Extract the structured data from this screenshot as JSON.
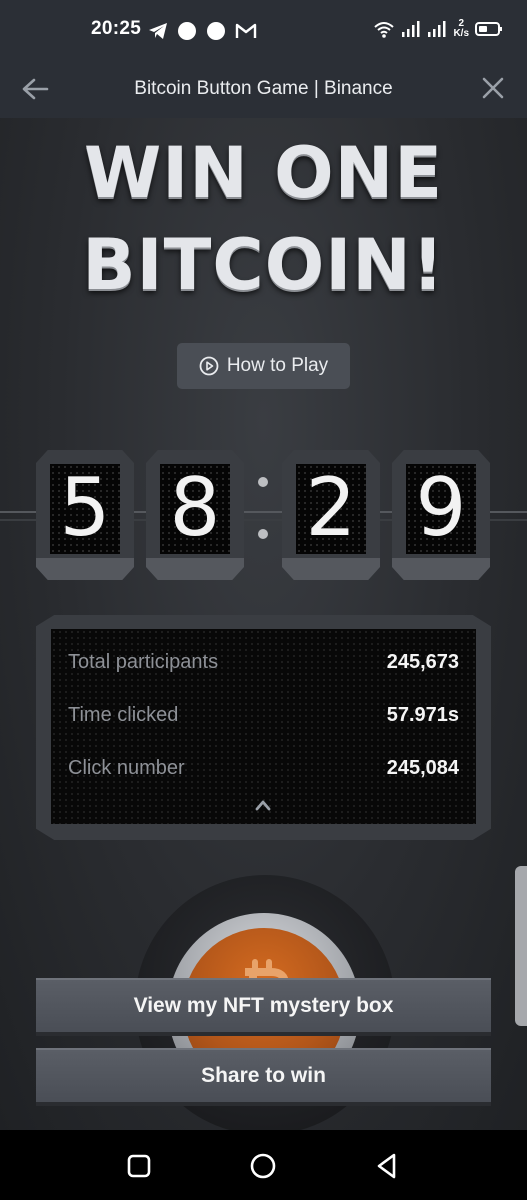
{
  "status_bar": {
    "time": "20:25",
    "net_speed_value": "2",
    "net_speed_unit": "K/s",
    "icons": [
      "telegram-icon",
      "circle-notification-icon",
      "circle-notification-icon",
      "gmail-icon",
      "wifi-icon",
      "signal-icon",
      "signal-icon",
      "battery-icon"
    ]
  },
  "app_bar": {
    "title": "Bitcoin Button Game | Binance",
    "back_icon": "arrow-left-icon",
    "close_icon": "close-icon"
  },
  "game": {
    "headline_line1": "WIN ONE",
    "headline_line2": "BITCOIN!",
    "how_to_play": "How to Play",
    "timer": {
      "digits": [
        "5",
        "8",
        "2",
        "9"
      ]
    },
    "stats": [
      {
        "label": "Total participants",
        "value": "245,673"
      },
      {
        "label": "Time clicked",
        "value": "57.971s"
      },
      {
        "label": "Click number",
        "value": "245,084"
      }
    ],
    "big_button_icon": "bitcoin-icon"
  },
  "actions": {
    "view_nft": "View my NFT mystery box",
    "share": "Share to win"
  },
  "colors": {
    "header_bg": "#2b2f36",
    "button_orange": "#c0601c",
    "digit_text": "#f2f2f2"
  }
}
